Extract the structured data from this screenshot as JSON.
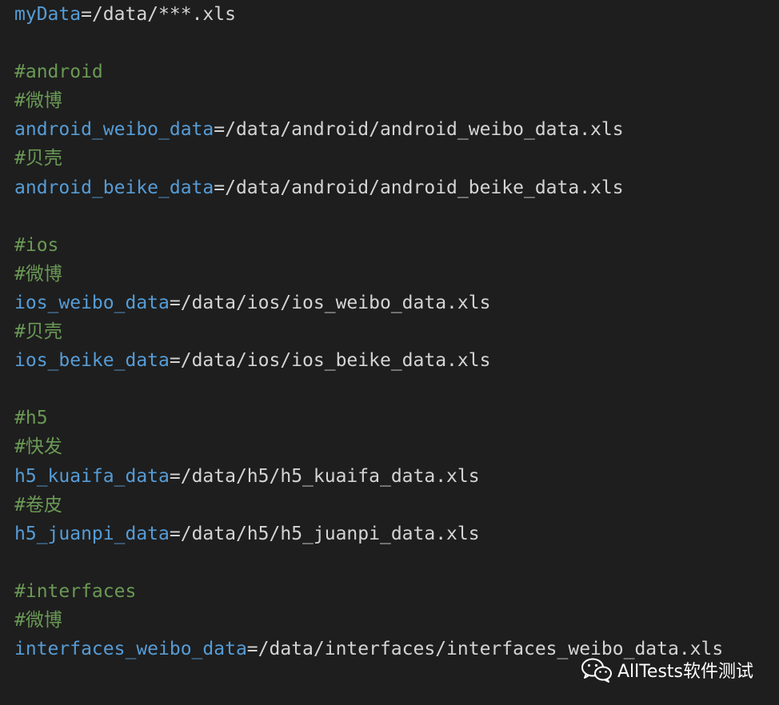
{
  "lines": [
    {
      "kind": "kv",
      "key": "myData",
      "value": "=/data/***.xls"
    },
    {
      "kind": "blank"
    },
    {
      "kind": "comment",
      "text": "#android"
    },
    {
      "kind": "comment",
      "text": "#微博"
    },
    {
      "kind": "kv",
      "key": "android_weibo_data",
      "value": "=/data/android/android_weibo_data.xls"
    },
    {
      "kind": "comment",
      "text": "#贝壳"
    },
    {
      "kind": "kv",
      "key": "android_beike_data",
      "value": "=/data/android/android_beike_data.xls"
    },
    {
      "kind": "blank"
    },
    {
      "kind": "comment",
      "text": "#ios"
    },
    {
      "kind": "comment",
      "text": "#微博"
    },
    {
      "kind": "kv",
      "key": "ios_weibo_data",
      "value": "=/data/ios/ios_weibo_data.xls"
    },
    {
      "kind": "comment",
      "text": "#贝壳"
    },
    {
      "kind": "kv",
      "key": "ios_beike_data",
      "value": "=/data/ios/ios_beike_data.xls"
    },
    {
      "kind": "blank"
    },
    {
      "kind": "comment",
      "text": "#h5"
    },
    {
      "kind": "comment",
      "text": "#快发"
    },
    {
      "kind": "kv",
      "key": "h5_kuaifa_data",
      "value": "=/data/h5/h5_kuaifa_data.xls"
    },
    {
      "kind": "comment",
      "text": "#卷皮"
    },
    {
      "kind": "kv",
      "key": "h5_juanpi_data",
      "value": "=/data/h5/h5_juanpi_data.xls"
    },
    {
      "kind": "blank"
    },
    {
      "kind": "comment",
      "text": "#interfaces"
    },
    {
      "kind": "comment",
      "text": "#微博"
    },
    {
      "kind": "kv",
      "key": "interfaces_weibo_data",
      "value": "=/data/interfaces/interfaces_weibo_data.xls"
    }
  ],
  "watermark": {
    "icon": "wechat-icon",
    "text": "AllTests软件测试"
  },
  "colors": {
    "background": "#1e1e1e",
    "key": "#569cd6",
    "value": "#d4d4d4",
    "comment": "#6a9955"
  }
}
